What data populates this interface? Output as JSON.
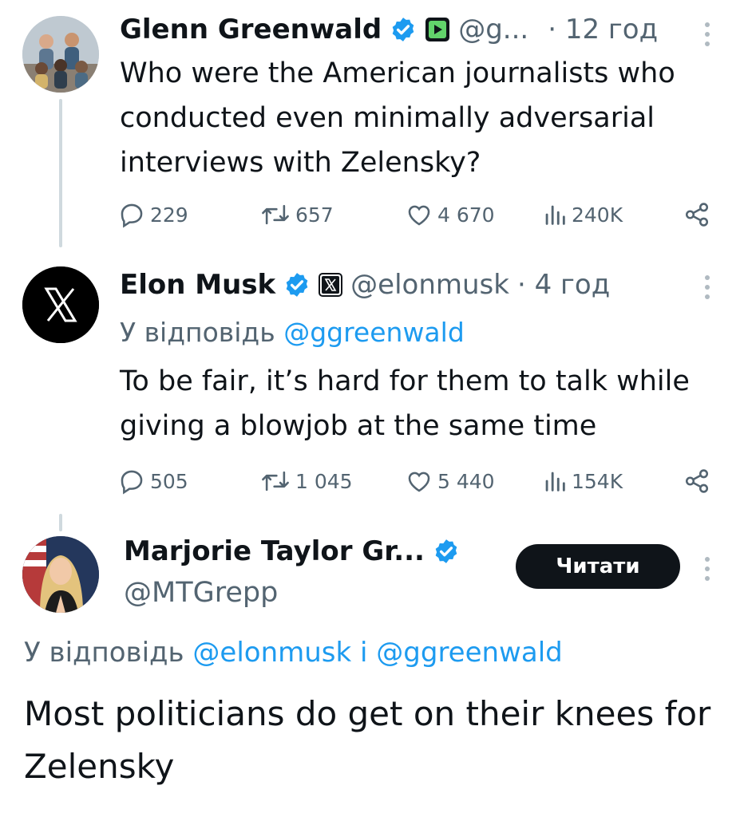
{
  "tweets": [
    {
      "author": "Glenn Greenwald",
      "handle": "@g...",
      "time": "· 12 год",
      "text": "Who were the American journalists who conducted even minimally adversarial interviews with Zelensky?",
      "stats": {
        "replies": "229",
        "reposts": "657",
        "likes": "4 670",
        "views": "240K"
      }
    },
    {
      "author": "Elon Musk",
      "handle": "@elonmusk",
      "time": "· 4 год",
      "reply_label": "У відповідь",
      "reply_mention": "@ggreenwald",
      "text": "To be fair, it’s hard for them to talk while giving a blowjob at the same time",
      "stats": {
        "replies": "505",
        "reposts": "1 045",
        "likes": "5 440",
        "views": "154K"
      }
    },
    {
      "author": "Marjorie Taylor Gr...",
      "handle": "@MTGrepp",
      "follow_label": "Читати",
      "reply_label": "У відповідь",
      "reply_mention_1": "@elonmusk",
      "reply_joiner": "і",
      "reply_mention_2": "@ggreenwald",
      "text": "Most politicians do get on their knees for Zelensky"
    }
  ],
  "colors": {
    "accent": "#1d9bf0",
    "muted": "#536471",
    "text": "#0f1419",
    "button": "#0f1419"
  }
}
